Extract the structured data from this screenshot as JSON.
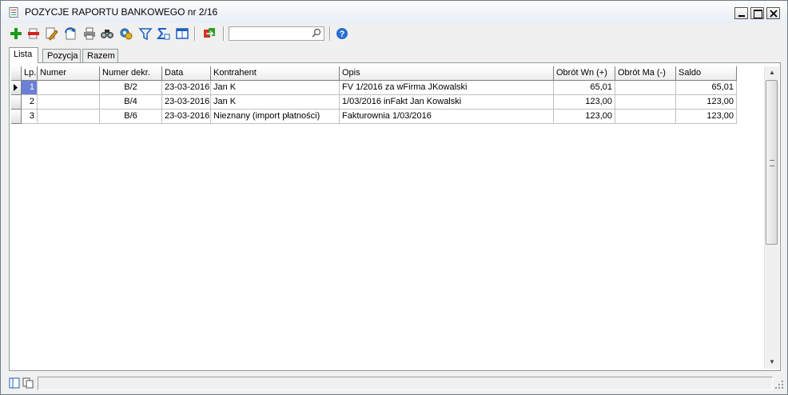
{
  "window": {
    "title": "POZYCJE RAPORTU BANKOWEGO nr 2/16"
  },
  "toolbar": {
    "buttons": [
      "add-icon",
      "delete-icon",
      "edit-icon",
      "refresh-icon",
      "print-icon",
      "find-icon",
      "settings-icon",
      "filter-icon",
      "sum-icon",
      "columns-icon",
      "export-icon",
      "help-icon"
    ],
    "search": {
      "value": "",
      "placeholder": ""
    }
  },
  "tabs": [
    "Lista",
    "Pozycja",
    "Razem"
  ],
  "grid": {
    "columns": [
      "Lp.",
      "Numer",
      "Numer dekr.",
      "Data",
      "Kontrahent",
      "Opis",
      "Obrót Wn (+)",
      "Obrót Ma (-)",
      "Saldo"
    ],
    "rows": [
      {
        "lp": "1",
        "numer": "",
        "dekr": "B/2",
        "data": "23-03-2016",
        "kontrahent": "Jan K",
        "opis": "FV 1/2016 za wFirma JKowalski",
        "wn": "65,01",
        "ma": "",
        "saldo": "65,01"
      },
      {
        "lp": "2",
        "numer": "",
        "dekr": "B/4",
        "data": "23-03-2016",
        "kontrahent": "Jan K",
        "opis": "1/03/2016 inFakt Jan Kowalski",
        "wn": "123,00",
        "ma": "",
        "saldo": "123,00"
      },
      {
        "lp": "3",
        "numer": "",
        "dekr": "B/6",
        "data": "23-03-2016",
        "kontrahent": "Nieznany (import płatności)",
        "opis": "Fakturownia 1/03/2016",
        "wn": "123,00",
        "ma": "",
        "saldo": "123,00"
      }
    ]
  },
  "colors": {
    "selection": "#6b7fd7",
    "accent": "#1e5fbf"
  }
}
